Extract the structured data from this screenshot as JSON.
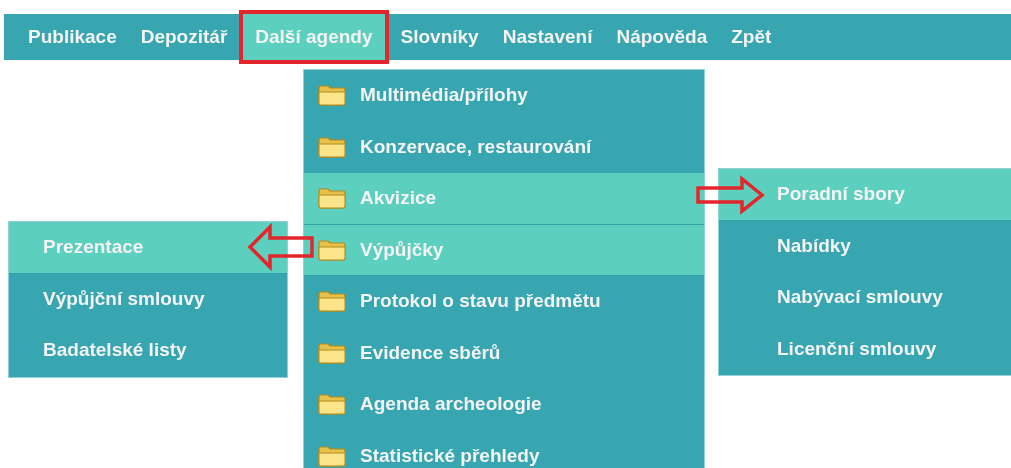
{
  "menu_bar": {
    "items": [
      {
        "label": "Publikace",
        "selected": false,
        "outlined": false
      },
      {
        "label": "Depozitář",
        "selected": false,
        "outlined": false
      },
      {
        "label": "Další agendy",
        "selected": true,
        "outlined": true
      },
      {
        "label": "Slovníky",
        "selected": false,
        "outlined": false
      },
      {
        "label": "Nastavení",
        "selected": false,
        "outlined": false
      },
      {
        "label": "Nápověda",
        "selected": false,
        "outlined": false
      },
      {
        "label": "Zpět",
        "selected": false,
        "outlined": false
      }
    ]
  },
  "dropdown": {
    "items": [
      {
        "label": "Multimédia/přílohy",
        "selected": false
      },
      {
        "label": "Konzervace, restaurování",
        "selected": false
      },
      {
        "label": "Akvizice",
        "selected": true
      },
      {
        "label": "Výpůjčky",
        "selected": true
      },
      {
        "label": "Protokol o stavu předmětu",
        "selected": false
      },
      {
        "label": "Evidence sběrů",
        "selected": false
      },
      {
        "label": "Agenda archeologie",
        "selected": false
      },
      {
        "label": "Statistické přehledy",
        "selected": false
      }
    ]
  },
  "left_submenu": {
    "items": [
      {
        "label": "Prezentace",
        "selected": true
      },
      {
        "label": "Výpůjční smlouvy",
        "selected": false
      },
      {
        "label": "Badatelské listy",
        "selected": false
      }
    ]
  },
  "right_submenu": {
    "items": [
      {
        "label": "Poradní sbory",
        "selected": true
      },
      {
        "label": "Nabídky",
        "selected": false
      },
      {
        "label": "Nabývací smlouvy",
        "selected": false
      },
      {
        "label": "Licenční smlouvy",
        "selected": false
      }
    ]
  }
}
